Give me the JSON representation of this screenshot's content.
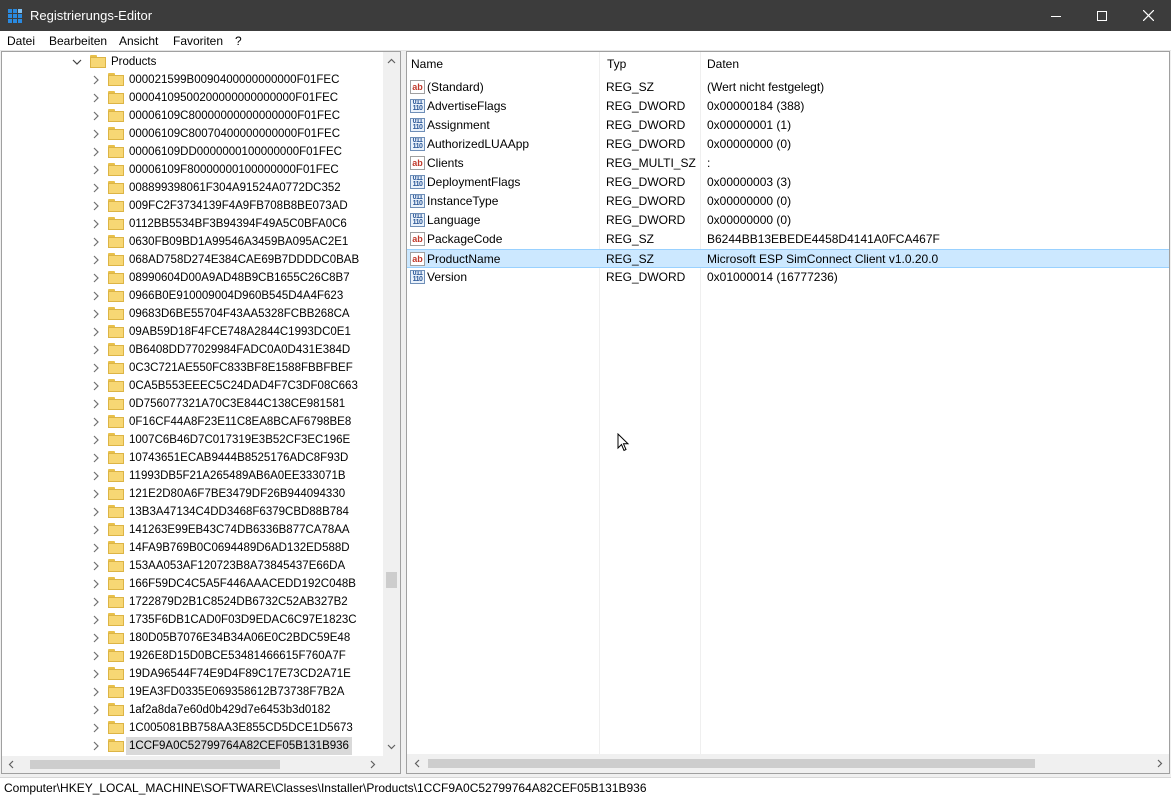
{
  "window": {
    "title": "Registrierungs-Editor",
    "minimize_icon": "minimize-icon",
    "maximize_icon": "maximize-icon",
    "close_icon": "close-icon"
  },
  "menu": [
    "Datei",
    "Bearbeiten",
    "Ansicht",
    "Favoriten",
    "?"
  ],
  "tree": {
    "parent": "Products",
    "children": [
      "000021599B0090400000000000F01FEC",
      "00004109500200000000000000F01FEC",
      "00006109C80000000000000000F01FEC",
      "00006109C80070400000000000F01FEC",
      "00006109DD0000000100000000F01FEC",
      "00006109F80000000100000000F01FEC",
      "008899398061F304A91524A0772DC352",
      "009FC2F3734139F4A9FB708B8BE073AD",
      "0112BB5534BF3B94394F49A5C0BFA0C6",
      "0630FB09BD1A99546A3459BA095AC2E1",
      "068AD758D274E384CAE69B7DDDDC0BAB",
      "08990604D00A9AD48B9CB1655C26C8B7",
      "0966B0E910009004D960B545D4A4F623",
      "09683D6BE55704F43AA5328FCBB268CA",
      "09AB59D18F4FCE748A2844C1993DC0E1",
      "0B6408DD77029984FADC0A0D431E384D",
      "0C3C721AE550FC833BF8E1588FBBFBEF",
      "0CA5B553EEEC5C24DAD4F7C3DF08C663",
      "0D756077321A70C3E844C138CE981581",
      "0F16CF44A8F23E11C8EA8BCAF6798BE8",
      "1007C6B46D7C017319E3B52CF3EC196E",
      "10743651ECAB9444B8525176ADC8F93D",
      "11993DB5F21A265489AB6A0EE333071B",
      "121E2D80A6F7BE3479DF26B944094330",
      "13B3A47134C4DD3468F6379CBD88B784",
      "141263E99EB43C74DB6336B877CA78AA",
      "14FA9B769B0C0694489D6AD132ED588D",
      "153AA053AF120723B8A73845437E66DA",
      "166F59DC4C5A5F446AAACEDD192C048B",
      "1722879D2B1C8524DB6732C52AB327B2",
      "1735F6DB1CAD0F03D9EDAC6C97E1823C",
      "180D05B7076E34B34A06E0C2BDC59E48",
      "1926E8D15D0BCE53481466615F760A7F",
      "19DA96544F74E9D4F89C17E73CD2A71E",
      "19EA3FD0335E069358612B73738F7B2A",
      "1af2a8da7e60d0b429d7e6453b3d0182",
      "1C005081BB758AA3E855CD5DCE1D5673",
      "1CCF9A0C52799764A82CEF05B131B936"
    ],
    "selected_index": 37
  },
  "list": {
    "headers": [
      "Name",
      "Typ",
      "Daten"
    ],
    "rows": [
      {
        "name": "(Standard)",
        "type": "REG_SZ",
        "data": "(Wert nicht festgelegt)",
        "icon": "string-value-icon"
      },
      {
        "name": "AdvertiseFlags",
        "type": "REG_DWORD",
        "data": "0x00000184 (388)",
        "icon": "binary-value-icon"
      },
      {
        "name": "Assignment",
        "type": "REG_DWORD",
        "data": "0x00000001 (1)",
        "icon": "binary-value-icon"
      },
      {
        "name": "AuthorizedLUAApp",
        "type": "REG_DWORD",
        "data": "0x00000000 (0)",
        "icon": "binary-value-icon"
      },
      {
        "name": "Clients",
        "type": "REG_MULTI_SZ",
        "data": ":",
        "icon": "string-value-icon"
      },
      {
        "name": "DeploymentFlags",
        "type": "REG_DWORD",
        "data": "0x00000003 (3)",
        "icon": "binary-value-icon"
      },
      {
        "name": "InstanceType",
        "type": "REG_DWORD",
        "data": "0x00000000 (0)",
        "icon": "binary-value-icon"
      },
      {
        "name": "Language",
        "type": "REG_DWORD",
        "data": "0x00000000 (0)",
        "icon": "binary-value-icon"
      },
      {
        "name": "PackageCode",
        "type": "REG_SZ",
        "data": "B6244BB13EBEDE4458D4141A0FCA467F",
        "icon": "string-value-icon"
      },
      {
        "name": "ProductName",
        "type": "REG_SZ",
        "data": "Microsoft ESP SimConnect Client v1.0.20.0",
        "icon": "string-value-icon"
      },
      {
        "name": "Version",
        "type": "REG_DWORD",
        "data": "0x01000014 (16777236)",
        "icon": "binary-value-icon"
      }
    ],
    "selected_index": 9
  },
  "status": {
    "path": "Computer\\HKEY_LOCAL_MACHINE\\SOFTWARE\\Classes\\Installer\\Products\\1CCF9A0C52799764A82CEF05B131B936"
  },
  "icon_glyphs": {
    "string": "ab",
    "binary": "011 110"
  },
  "colors": {
    "titlebar": "#3c3c3c",
    "selection": "#cce8ff",
    "tree_selection": "#d9d9d9",
    "folder": "#f7d774"
  }
}
